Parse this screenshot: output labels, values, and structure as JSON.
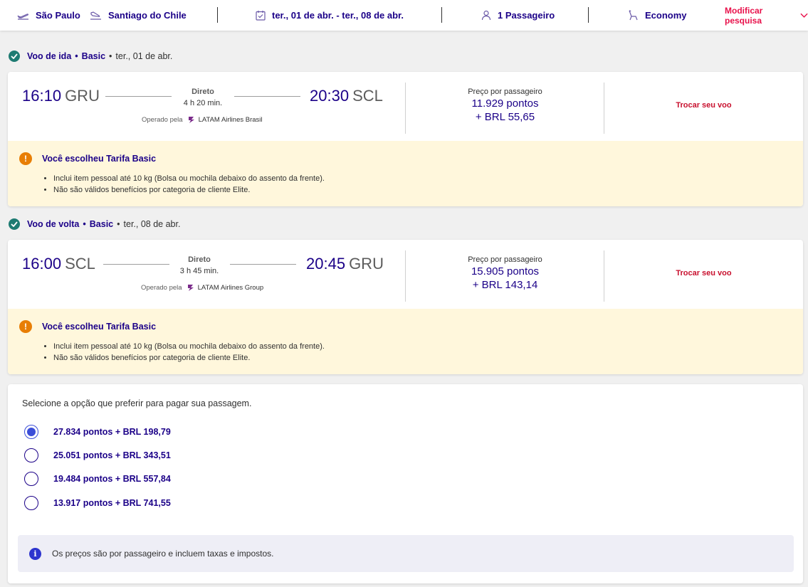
{
  "topbar": {
    "origin": "São Paulo",
    "destination": "Santiago do Chile",
    "dates": "ter., 01 de abr. - ter., 08 de abr.",
    "passengers": "1 Passageiro",
    "cabin": "Economy",
    "modify_label": "Modificar pesquisa"
  },
  "outbound": {
    "header_title": "Voo de ida",
    "header_fare": "Basic",
    "header_date": "ter., 01 de abr.",
    "dep_time": "16:10",
    "dep_code": "GRU",
    "arr_time": "20:30",
    "arr_code": "SCL",
    "stops": "Direto",
    "duration": "4 h 20 min.",
    "operated_label": "Operado pela",
    "carrier": "LATAM Airlines Brasil",
    "price_label": "Preço por passageiro",
    "price_points": "11.929 pontos",
    "price_brl": "+ BRL 55,65",
    "change_label": "Trocar seu voo",
    "fare_title": "Você escolheu Tarifa Basic",
    "fare_items": [
      "Inclui item pessoal até 10 kg (Bolsa ou mochila debaixo do assento da frente).",
      "Não são válidos benefícios por categoria de cliente Elite."
    ]
  },
  "inbound": {
    "header_title": "Voo de volta",
    "header_fare": "Basic",
    "header_date": "ter., 08 de abr.",
    "dep_time": "16:00",
    "dep_code": "SCL",
    "arr_time": "20:45",
    "arr_code": "GRU",
    "stops": "Direto",
    "duration": "3 h 45 min.",
    "operated_label": "Operado pela",
    "carrier": "LATAM Airlines Group",
    "price_label": "Preço por passageiro",
    "price_points": "15.905 pontos",
    "price_brl": "+ BRL 143,14",
    "change_label": "Trocar seu voo",
    "fare_title": "Você escolheu Tarifa Basic",
    "fare_items": [
      "Inclui item pessoal até 10 kg (Bolsa ou mochila debaixo do assento da frente).",
      "Não são válidos benefícios por categoria de cliente Elite."
    ]
  },
  "payment": {
    "title": "Selecione a opção que preferir para pagar sua passagem.",
    "options": [
      {
        "label": "27.834 pontos + BRL 198,79",
        "selected": true
      },
      {
        "label": "25.051 pontos + BRL 343,51",
        "selected": false
      },
      {
        "label": "19.484 pontos + BRL 557,84",
        "selected": false
      },
      {
        "label": "13.917 pontos + BRL 741,55",
        "selected": false
      }
    ],
    "info": "Os preços são por passageiro e incluem taxas e impostos."
  },
  "colors": {
    "brand_navy": "#1b0088",
    "link_red": "#c8102e",
    "check_green": "#1e7b72",
    "warning_orange": "#e87e04",
    "radio_blue": "#3b4ed8"
  }
}
